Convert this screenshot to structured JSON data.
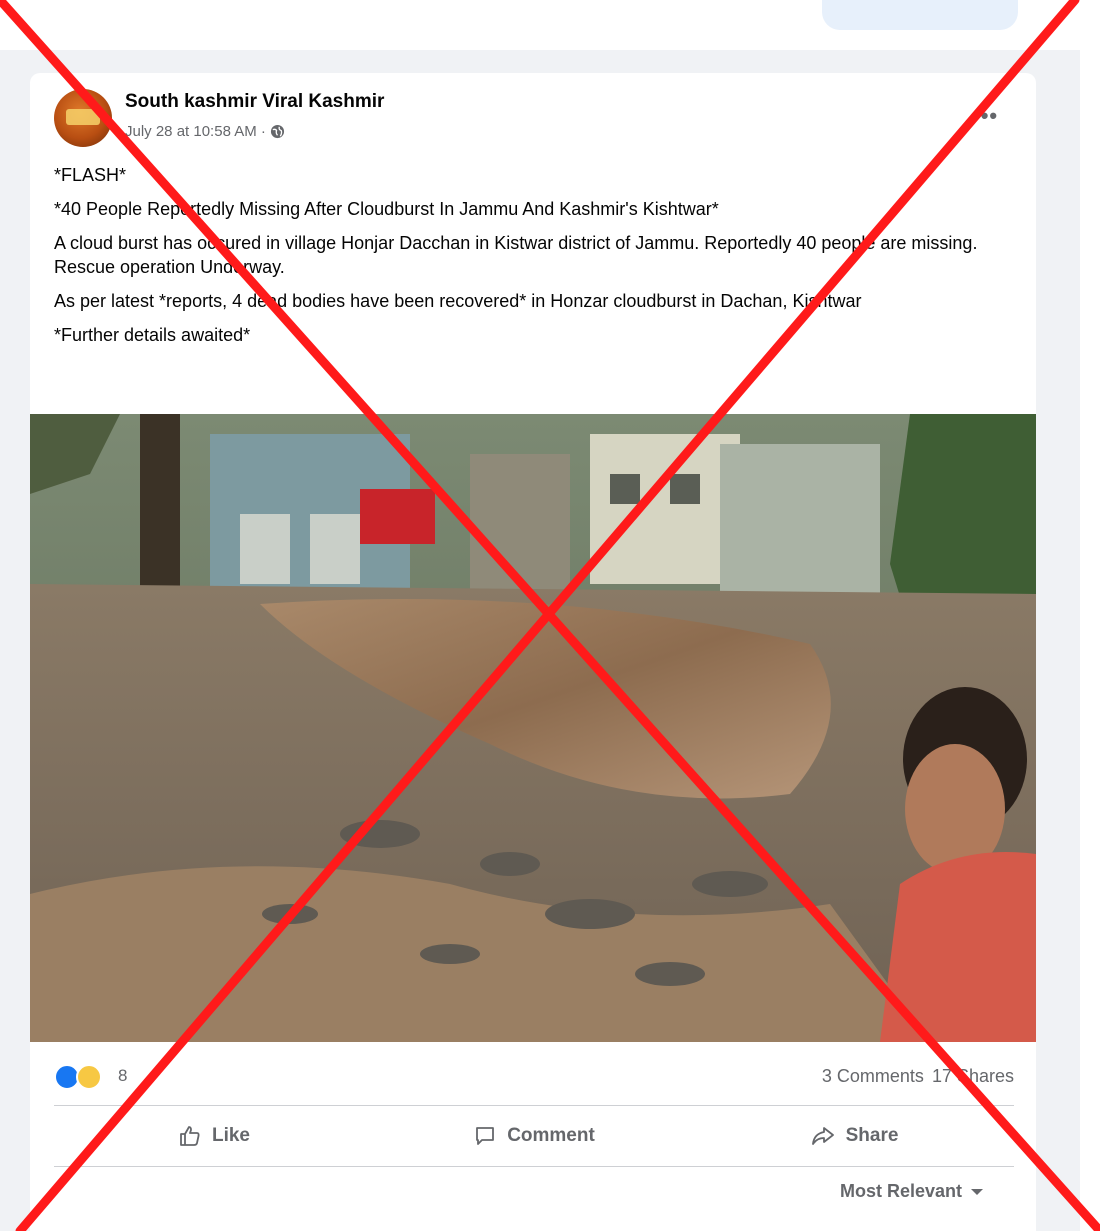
{
  "post": {
    "author": "South kashmir Viral Kashmir",
    "timestamp": "July 28 at 10:58 AM ·",
    "privacy_icon": "globe-icon",
    "more_icon": "more-options-icon",
    "lines": [
      "*FLASH*",
      "*40 People Reportedly Missing After Cloudburst In Jammu And Kashmir's Kishtwar*",
      "A cloud burst has occured in village Honjar Dacchan in Kistwar district of Jammu. Reportedly 40 people are missing. Rescue operation Underway.",
      "As per latest *reports, 4 dead bodies have been recovered* in Honzar cloudburst in Dachan, Kishtwar",
      "*Further details awaited*"
    ],
    "image_description_icon": "flood-photo"
  },
  "stats": {
    "reaction_count": "8",
    "comments": "3 Comments",
    "shares": "17 Shares"
  },
  "actions": {
    "like": "Like",
    "comment": "Comment",
    "share": "Share"
  },
  "sort": {
    "label": "Most Relevant"
  },
  "colors": {
    "facebook_blue": "#1877f2",
    "cross_red": "#ff1a1a",
    "muted_text": "#65676b"
  }
}
